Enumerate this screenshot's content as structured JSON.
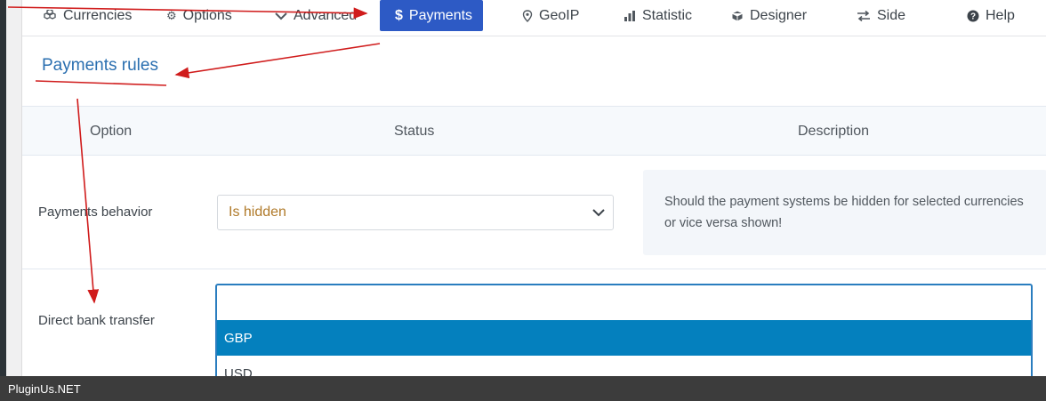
{
  "tabs": [
    {
      "label": "Currencies",
      "icon": "cubes-icon"
    },
    {
      "label": "Options",
      "icon": "gear-icon"
    },
    {
      "label": "Advanced",
      "icon": "chevron-icon"
    },
    {
      "label": "Payments",
      "icon": "dollar-icon",
      "active": true
    },
    {
      "label": "GeoIP",
      "icon": "map-pin-icon"
    },
    {
      "label": "Statistic",
      "icon": "bar-chart-icon"
    },
    {
      "label": "Designer",
      "icon": "cube-icon"
    },
    {
      "label": "Side",
      "icon": "swap-icon"
    },
    {
      "label": "Help",
      "icon": "question-circle-icon"
    }
  ],
  "section": {
    "title": "Payments rules"
  },
  "table": {
    "headers": {
      "option": "Option",
      "status": "Status",
      "description": "Description"
    },
    "rows": [
      {
        "label": "Payments behavior",
        "select_value": "Is hidden",
        "description": "Should the payment systems be hidden for selected currencies or vice versa shown!"
      },
      {
        "label": "Direct bank transfer",
        "search_value": "",
        "options": [
          "GBP",
          "USD"
        ],
        "highlighted": "GBP"
      }
    ]
  },
  "watermark": "PluginUs.NET",
  "colors": {
    "accent": "#2d5ac5",
    "annotation_arrow": "#d01c1c",
    "dropdown_highlight": "#0480be"
  }
}
